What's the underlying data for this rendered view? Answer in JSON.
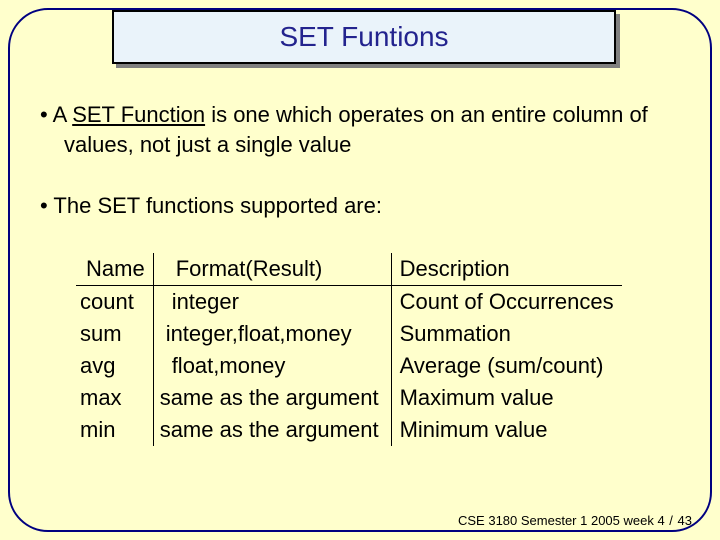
{
  "title": "SET Funtions",
  "bullets": {
    "b1_pre": "A ",
    "b1_underline": "SET Function",
    "b1_post": " is one which operates on an entire column of values, not just a single value",
    "b2": "The SET functions supported are:"
  },
  "table": {
    "headers": {
      "name": "Name",
      "format": "Format(Result)",
      "desc": "Description"
    },
    "rows": [
      {
        "name": "count",
        "format": "integer",
        "desc": "Count of Occurrences"
      },
      {
        "name": "sum",
        "format": "integer,float,money",
        "desc": "Summation"
      },
      {
        "name": "avg",
        "format": "float,money",
        "desc": "Average (sum/count)"
      },
      {
        "name": "max",
        "format": "same as the argument",
        "desc": "Maximum value"
      },
      {
        "name": "min",
        "format": "same as the argument",
        "desc": "Minimum value"
      }
    ]
  },
  "footer": {
    "course": "CSE 3180 Semester 1 2005  week 4",
    "page": "43"
  }
}
